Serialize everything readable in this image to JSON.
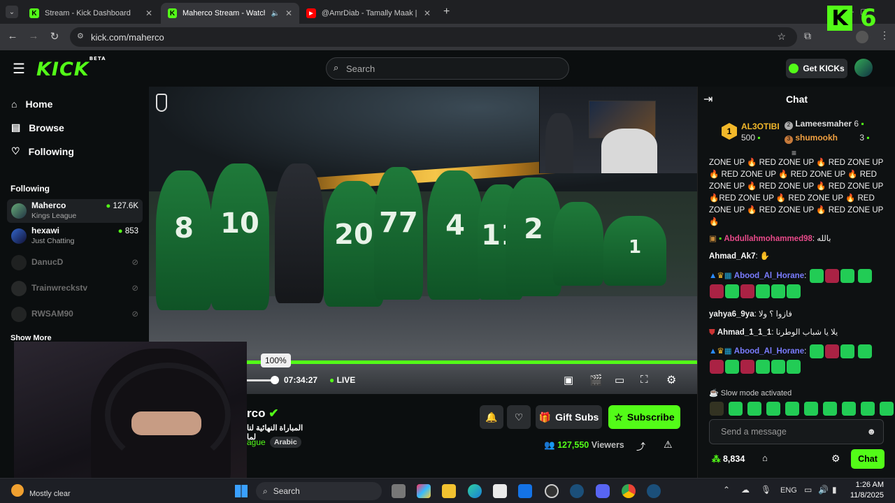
{
  "browser": {
    "tabs": [
      {
        "title": "Stream - Kick Dashboard",
        "favicon": "K"
      },
      {
        "title": "Maherco Stream - Watch Li",
        "favicon": "K"
      },
      {
        "title": "@AmrDiab - Tamally Maak | Off",
        "favicon": "▶"
      }
    ],
    "url": "kick.com/maherco",
    "new_tab": "+"
  },
  "header": {
    "logo": "KICK",
    "logo_badge": "BETA",
    "search_placeholder": "Search",
    "get_kicks": "Get KICKs"
  },
  "sidebar": {
    "nav": [
      {
        "label": "Home",
        "icon": "home-icon"
      },
      {
        "label": "Browse",
        "icon": "browse-icon"
      },
      {
        "label": "Following",
        "icon": "heart-icon"
      }
    ],
    "section_title": "Following",
    "channels": [
      {
        "name": "Maherco",
        "game": "Kings League",
        "viewers": "127.6K",
        "live": true
      },
      {
        "name": "hexawi",
        "game": "Just Chatting",
        "viewers": "853",
        "live": true
      },
      {
        "name": "DanucD",
        "live": false
      },
      {
        "name": "Trainwreckstv",
        "live": false
      },
      {
        "name": "RWSAM90",
        "live": false
      }
    ],
    "show_more": "Show More"
  },
  "player": {
    "volume_tooltip": "100%",
    "time": "07:34:27",
    "live_label": "LIVE",
    "progress": 1.0
  },
  "stream_info": {
    "channel_name_partial": "rco",
    "title_partial": "المباراة النهائية لنا لما",
    "category_partial": "ague",
    "tag": "Arabic",
    "viewers": "127,550",
    "viewers_label": "Viewers",
    "gift_subs": "Gift Subs",
    "subscribe": "Subscribe"
  },
  "chat": {
    "title": "Chat",
    "leaderboard": [
      {
        "rank": "1",
        "name": "AL3OTIBI",
        "amount": "500"
      },
      {
        "rank": "2",
        "name": "Lameesmaher",
        "amount": "6"
      },
      {
        "rank": "3",
        "name": "shumookh",
        "amount": "3"
      }
    ],
    "spam_lines": [
      "ZONE UP 🔥 RED ZONE UP 🔥 RED ZONE UP",
      "🔥 RED ZONE UP 🔥 RED ZONE UP 🔥 RED",
      "ZONE UP 🔥 RED ZONE UP 🔥 RED ZONE UP",
      "🔥RED ZONE UP 🔥 RED ZONE UP 🔥 RED",
      "ZONE UP 🔥 RED ZONE UP 🔥 RED ZONE UP",
      "🔥"
    ],
    "messages": [
      {
        "user": "Abdullahmohammed98",
        "text": "بالله",
        "color": "#e84a8a"
      },
      {
        "user": "Ahmad_Ak7",
        "text": "",
        "color": "#ffffff"
      },
      {
        "user": "Abood_Al_Horane",
        "text": "",
        "color": "#7a7cff"
      },
      {
        "user": "yahya6_9ya",
        "text": "فازوا ؟ ولا",
        "color": "#ffffff"
      },
      {
        "user": "Ahmad_1_1_1",
        "text": "يلا يا شباب الوطرنا",
        "color": "#ffffff"
      },
      {
        "user": "Abood_Al_Horane",
        "text": "",
        "color": "#7a7cff"
      }
    ],
    "slow_mode": "Slow mode activated",
    "input_placeholder": "Send a message",
    "points": "8,834",
    "send_button": "Chat"
  },
  "taskbar": {
    "weather": "Mostly clear",
    "search": "Search",
    "lang": "ENG",
    "time": "1:26 AM",
    "date": "11/8/2025"
  },
  "overlay_counter": "6",
  "colors": {
    "kick_green": "#53fc18",
    "bg": "#0b0e0f",
    "live_green": "#53fc18"
  }
}
